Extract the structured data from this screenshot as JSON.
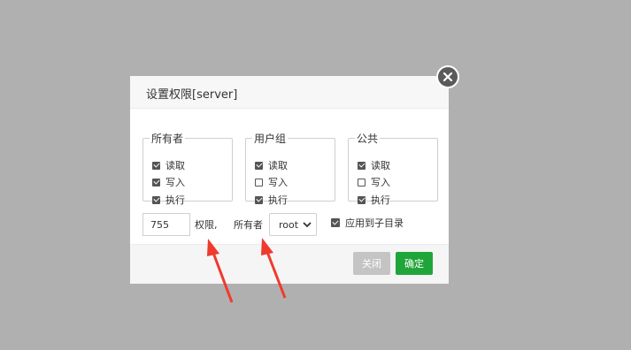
{
  "dialog": {
    "title": "设置权限[server]",
    "groups": [
      {
        "legend": "所有者",
        "items": [
          {
            "label": "读取",
            "checked": true
          },
          {
            "label": "写入",
            "checked": true
          },
          {
            "label": "执行",
            "checked": true
          }
        ]
      },
      {
        "legend": "用户组",
        "items": [
          {
            "label": "读取",
            "checked": true
          },
          {
            "label": "写入",
            "checked": false
          },
          {
            "label": "执行",
            "checked": true
          }
        ]
      },
      {
        "legend": "公共",
        "items": [
          {
            "label": "读取",
            "checked": true
          },
          {
            "label": "写入",
            "checked": false
          },
          {
            "label": "执行",
            "checked": true
          }
        ]
      }
    ],
    "permission": {
      "value": "755",
      "label": "权限,"
    },
    "owner": {
      "label": "所有者",
      "selected": "root"
    },
    "apply_subdir": {
      "label": "应用到子目录",
      "checked": true
    },
    "buttons": {
      "close": "关闭",
      "ok": "确定"
    }
  },
  "colors": {
    "overlay": "#b0b0b0",
    "ok_button": "#20a53a",
    "close_button": "#c4c4c4",
    "annotation_arrow": "#f03a2e"
  },
  "icons": {
    "close": "close-icon",
    "select": "chevron-down-icon",
    "checkbox": "checkbox-icon"
  }
}
